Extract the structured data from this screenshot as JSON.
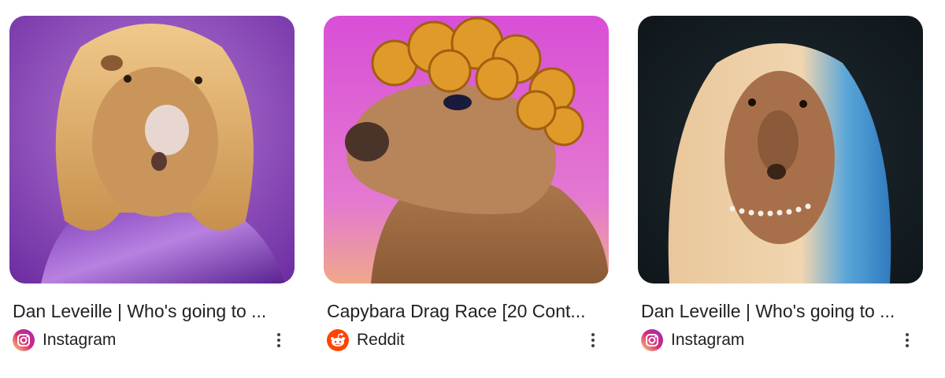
{
  "results": [
    {
      "title": "Dan Leveille | Who's going to ...",
      "source": "Instagram",
      "source_icon": "instagram-icon",
      "image_desc": "capybara-with-blonde-wig-purple-outfit"
    },
    {
      "title": "Capybara Drag Race [20 Cont...",
      "source": "Reddit",
      "source_icon": "reddit-icon",
      "image_desc": "capybara-with-curly-orange-wig"
    },
    {
      "title": "Dan Leveille | Who's going to ...",
      "source": "Instagram",
      "source_icon": "instagram-icon",
      "image_desc": "capybara-with-long-blonde-blue-wig-necklace"
    }
  ],
  "colors": {
    "text": "#202124",
    "instagram_gradient": [
      "#feda75",
      "#d62976",
      "#962fbf"
    ],
    "reddit": "#ff4500"
  }
}
